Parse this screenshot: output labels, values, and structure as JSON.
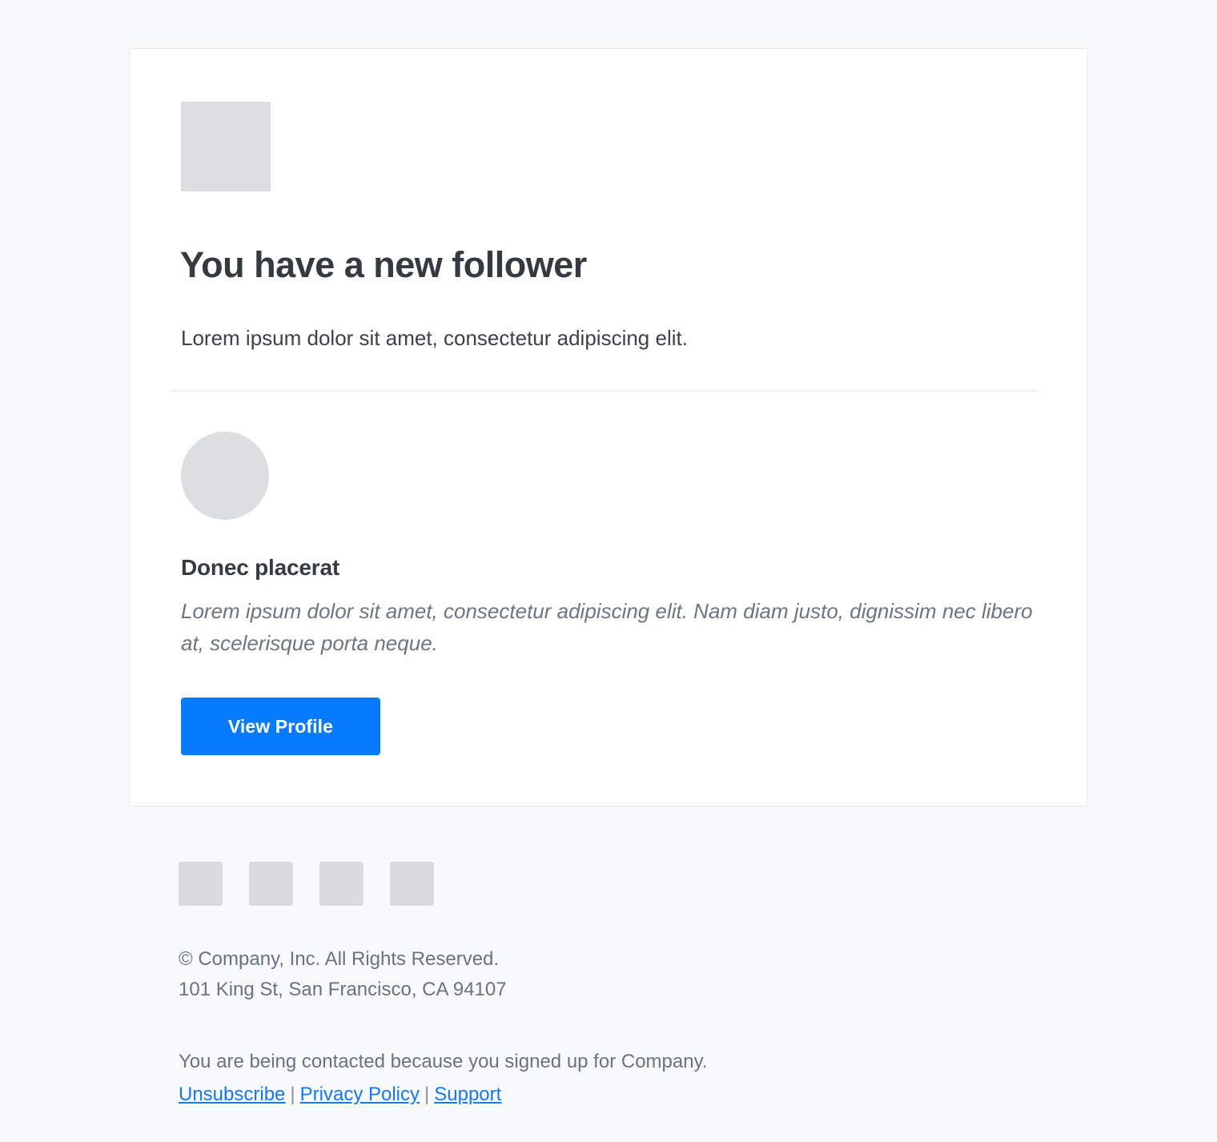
{
  "card": {
    "logo": {
      "icon": "logo-placeholder-square"
    },
    "headline": "You have a new follower",
    "intro_text": "Lorem ipsum dolor sit amet, consectetur adipiscing elit.",
    "follower": {
      "avatar_icon": "avatar-placeholder-circle",
      "name": "Donec placerat",
      "bio": "Lorem ipsum dolor sit amet, consectetur adipiscing elit. Nam diam justo, dignissim nec libero at, scelerisque porta neque."
    },
    "cta": {
      "label": "View Profile"
    }
  },
  "footer": {
    "social_icons": [
      {
        "icon": "social-icon-placeholder-1"
      },
      {
        "icon": "social-icon-placeholder-2"
      },
      {
        "icon": "social-icon-placeholder-3"
      },
      {
        "icon": "social-icon-placeholder-4"
      }
    ],
    "copyright": "© Company, Inc. All Rights Reserved.",
    "address": "101 King St, San Francisco, CA 94107",
    "contact_reason": "You are being contacted because you signed up for Company.",
    "links": {
      "unsubscribe": "Unsubscribe",
      "privacy_policy": "Privacy Policy",
      "support": "Support",
      "separator": "|"
    }
  },
  "colors": {
    "page_background": "#f7f9fb",
    "card_background": "#ffffff",
    "card_border": "#e6e7e9",
    "heading_text": "#343a40",
    "body_text": "#3c4248",
    "muted_text": "#6b7280",
    "italic_text": "#6b7680",
    "placeholder_gray": "#dcdee0",
    "accent_blue": "#077bff",
    "link_blue": "#1877f2",
    "divider": "#eceef0"
  }
}
